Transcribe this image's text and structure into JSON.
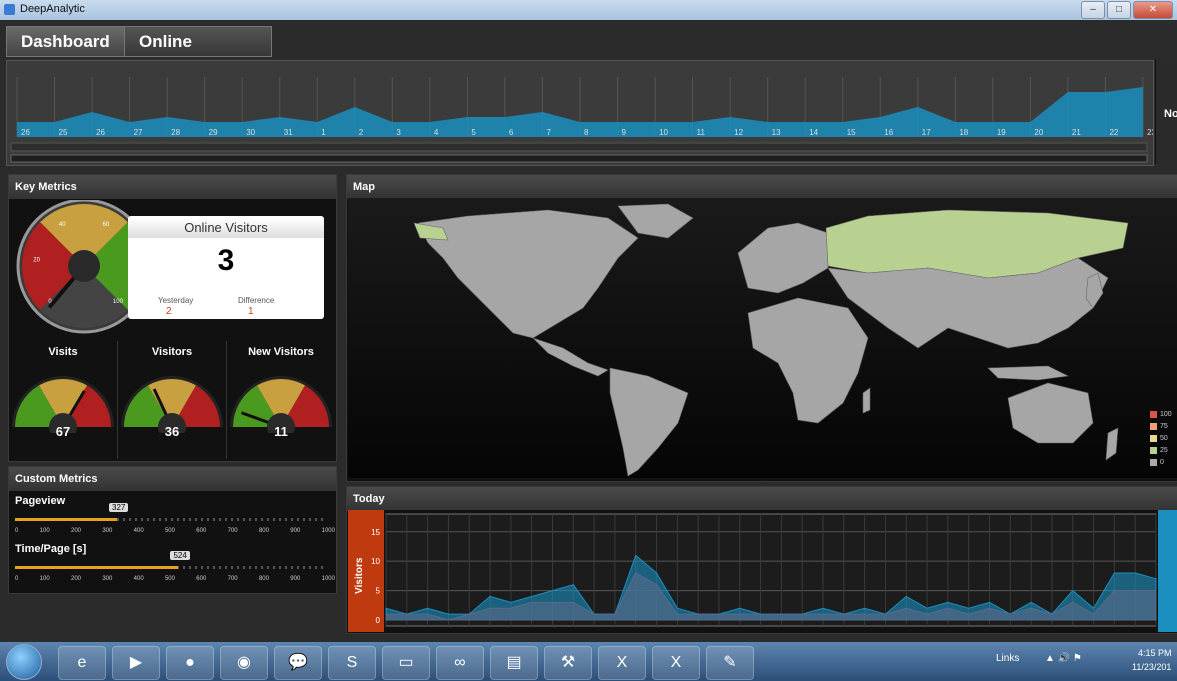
{
  "window": {
    "title": "DeepAnalytic"
  },
  "tabs": [
    {
      "label": "Dashboard"
    },
    {
      "label": "Online Visitors"
    }
  ],
  "timeline": {
    "day_labels": [
      "26",
      "25",
      "26",
      "27",
      "28",
      "29",
      "30",
      "31",
      "1",
      "2",
      "3",
      "4",
      "5",
      "6",
      "7",
      "8",
      "9",
      "10",
      "11",
      "12",
      "13",
      "14",
      "15",
      "16",
      "17",
      "18",
      "19",
      "20",
      "21",
      "22",
      "23"
    ],
    "values": [
      3,
      3,
      5,
      3,
      4,
      3,
      3,
      4,
      3,
      6,
      3,
      3,
      4,
      4,
      5,
      3,
      3,
      3,
      3,
      4,
      3,
      3,
      3,
      4,
      6,
      3,
      3,
      3,
      9,
      9,
      10
    ],
    "right_text": "No"
  },
  "key_metrics": {
    "title": "Key Metrics",
    "main_gauge": {
      "tick_labels": [
        "0",
        "20",
        "40",
        "60",
        "80",
        "100"
      ]
    },
    "online_visitors": {
      "title": "Online Visitors",
      "value": "3",
      "yesterday_label": "Yesterday",
      "yesterday_value": "2",
      "difference_label": "Difference",
      "difference_value": "1"
    },
    "small_gauges": [
      {
        "title": "Visits",
        "value": "67"
      },
      {
        "title": "Visitors",
        "value": "36"
      },
      {
        "title": "New Visitors",
        "value": "11"
      }
    ]
  },
  "custom_metrics": {
    "title": "Custom Metrics",
    "pageview": {
      "label": "Pageview",
      "value": "327",
      "fraction": 0.327
    },
    "time_page": {
      "label": "Time/Page [s]",
      "value": "524",
      "fraction": 0.524
    },
    "ticks": [
      "0",
      "100",
      "200",
      "300",
      "400",
      "500",
      "600",
      "700",
      "800",
      "900",
      "1000"
    ]
  },
  "map": {
    "title": "Map",
    "legend": [
      {
        "label": "100",
        "color": "#d9534f"
      },
      {
        "label": "75",
        "color": "#f0a070"
      },
      {
        "label": "50",
        "color": "#e8d890"
      },
      {
        "label": "25",
        "color": "#b8d090"
      },
      {
        "label": "0",
        "color": "#aaaaaa"
      }
    ]
  },
  "today": {
    "title": "Today",
    "ylabel": "Visitors",
    "yticks": [
      "15",
      "10",
      "5",
      "0"
    ],
    "series": [
      {
        "values": [
          2,
          1,
          2,
          1,
          1,
          4,
          3,
          4,
          5,
          6,
          1,
          1,
          11,
          8,
          2,
          1,
          1,
          2,
          1,
          1,
          1,
          2,
          1,
          2,
          1,
          4,
          2,
          3,
          2,
          3,
          1,
          3,
          1,
          5,
          2,
          8,
          8,
          7
        ]
      },
      {
        "values": [
          1,
          1,
          1,
          0,
          1,
          2,
          2,
          3,
          3,
          3,
          1,
          1,
          8,
          6,
          1,
          1,
          1,
          1,
          1,
          1,
          1,
          1,
          1,
          1,
          1,
          2,
          1,
          2,
          1,
          2,
          1,
          2,
          1,
          3,
          1,
          5,
          5,
          5
        ]
      }
    ]
  },
  "taskbar": {
    "apps": [
      "ie",
      "media",
      "firefox",
      "chrome",
      "talk",
      "skype",
      "explorer",
      "vs",
      "doc",
      "tool",
      "xamarin",
      "excel",
      "pad"
    ],
    "links": "Links",
    "time": "4:15 PM",
    "date": "11/23/201"
  }
}
